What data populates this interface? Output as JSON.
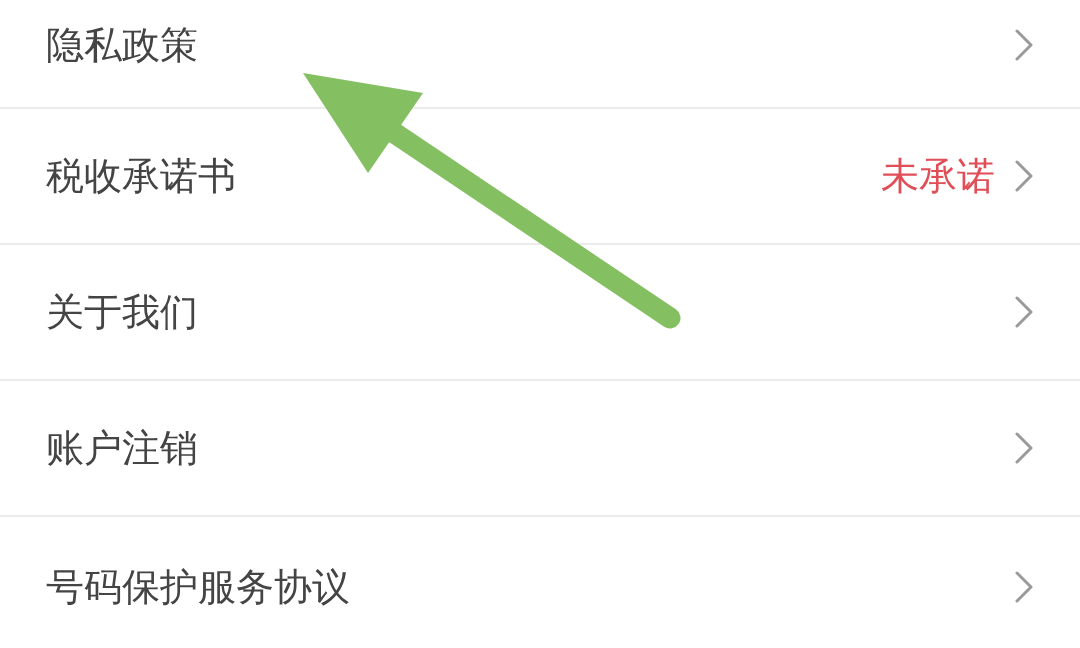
{
  "settings_list": {
    "items": [
      {
        "label": "隐私政策"
      },
      {
        "label": "税收承诺书",
        "status": "未承诺"
      },
      {
        "label": "关于我们"
      },
      {
        "label": "账户注销"
      },
      {
        "label": "号码保护服务协议"
      }
    ]
  }
}
